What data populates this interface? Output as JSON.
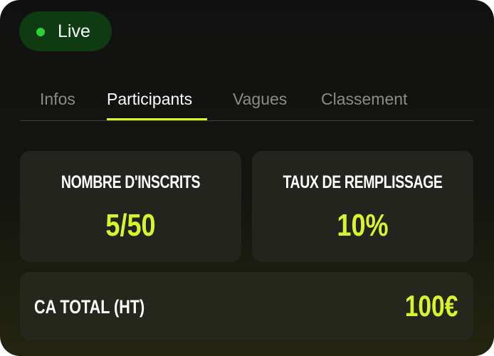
{
  "status": {
    "label": "Live",
    "dot_color": "#2fd13a",
    "badge_color": "#0f3a12"
  },
  "tabs": [
    {
      "label": "Infos",
      "active": false
    },
    {
      "label": "Participants",
      "active": true
    },
    {
      "label": "Vagues",
      "active": false
    },
    {
      "label": "Classement",
      "active": false
    }
  ],
  "stats": {
    "inscrits": {
      "label": "NOMBRE D'INSCRITS",
      "value": "5/50"
    },
    "remplissage": {
      "label": "TAUX DE REMPLISSAGE",
      "value": "10%"
    },
    "ca_total": {
      "label": "CA TOTAL (HT)",
      "value": "100€"
    }
  },
  "colors": {
    "accent": "#d7f52a",
    "background": "#111111",
    "tile": "#23241d",
    "inactive_tab": "#8a8a86"
  }
}
